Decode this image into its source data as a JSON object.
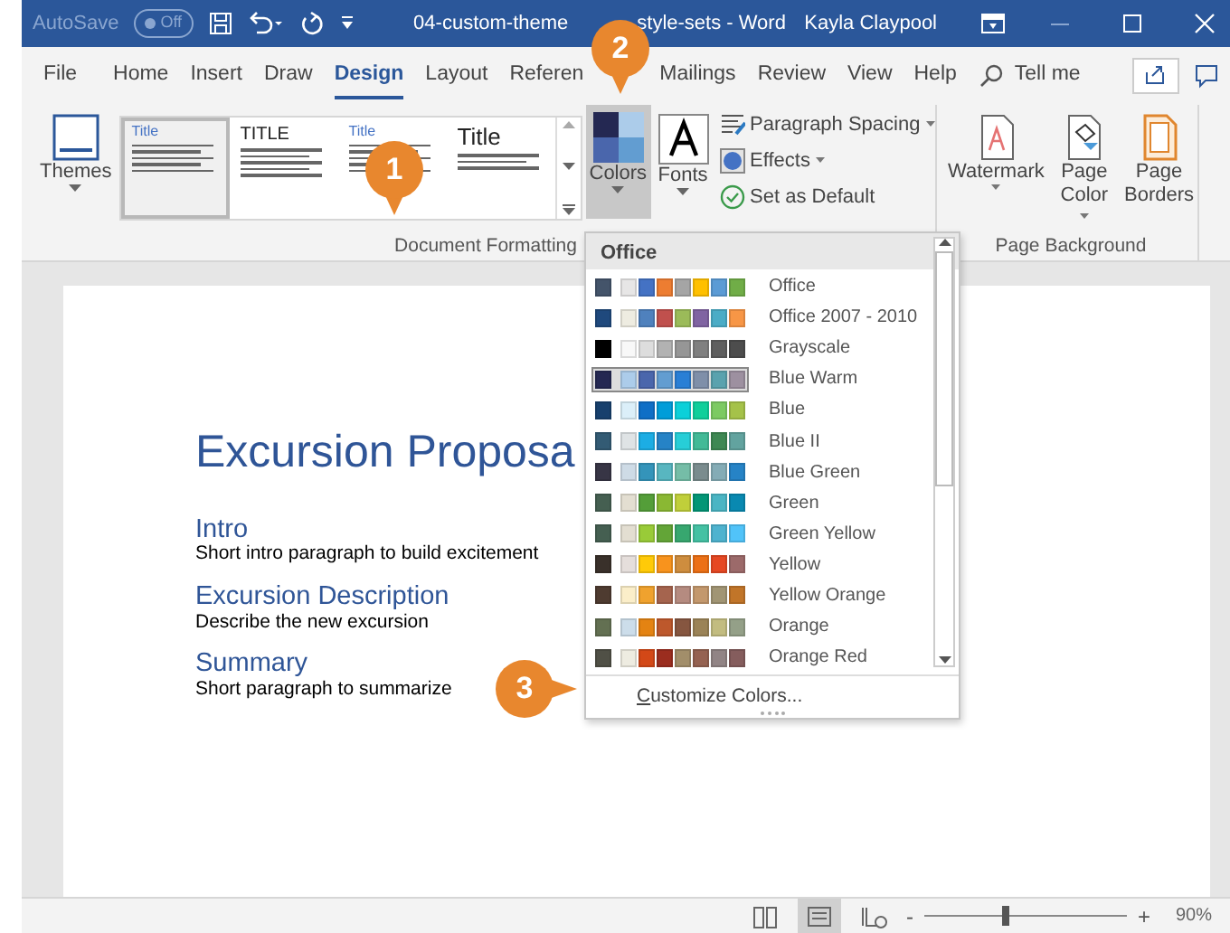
{
  "title_bar": {
    "autosave": "AutoSave",
    "autosave_toggle": "Off",
    "title_parts": [
      "04-custom-theme",
      "style-sets - Word"
    ],
    "user": "Kayla Claypool"
  },
  "tabs": [
    {
      "label": "File",
      "selected": false
    },
    {
      "label": "Home",
      "selected": false
    },
    {
      "label": "Insert",
      "selected": false
    },
    {
      "label": "Draw",
      "selected": false
    },
    {
      "label": "Design",
      "selected": true
    },
    {
      "label": "Layout",
      "selected": false
    },
    {
      "label": "Referen",
      "selected": false
    },
    {
      "label": "Mailings",
      "selected": false
    },
    {
      "label": "Review",
      "selected": false
    },
    {
      "label": "View",
      "selected": false
    },
    {
      "label": "Help",
      "selected": false
    }
  ],
  "tell_me": "Tell me",
  "ribbon": {
    "themes": "Themes",
    "style_gallery": [
      {
        "title": "Title",
        "selected": true
      },
      {
        "title": "TITLE",
        "selected": false
      },
      {
        "title": "Title",
        "selected": false
      },
      {
        "title": "Title",
        "selected": false
      }
    ],
    "colors": "Colors",
    "fonts": "Fonts",
    "small_buttons": [
      {
        "label": "Paragraph Spacing",
        "dropdown": true,
        "kind": "spacing"
      },
      {
        "label": "Effects",
        "dropdown": true,
        "kind": "effects"
      },
      {
        "label": "Set as Default",
        "dropdown": false,
        "kind": "default"
      }
    ],
    "document_formatting": "Document Formatting",
    "page_buttons": [
      {
        "label": "Watermark",
        "dropdown": true,
        "kind": "watermark"
      },
      {
        "label": "Page Color",
        "dropdown": true,
        "kind": "color"
      },
      {
        "label": "Page Borders",
        "dropdown": false,
        "kind": "borders"
      }
    ],
    "page_background": "Page Background"
  },
  "document": {
    "title": "Excursion Proposa",
    "sections": [
      {
        "heading": "Intro",
        "body": "Short intro paragraph to build excitement"
      },
      {
        "heading": "Excursion Description",
        "body": "Describe the new excursion"
      },
      {
        "heading": "Summary",
        "body": "Short paragraph to summarize"
      }
    ]
  },
  "colors_menu": {
    "header": "Office",
    "palettes": [
      {
        "name": "Office",
        "selected": false,
        "swatches": [
          {
            "color": "#44546a"
          },
          {
            "color": "#e7e6e6"
          },
          {
            "color": "#4472c4"
          },
          {
            "color": "#ed7d31"
          },
          {
            "color": "#a5a5a5"
          },
          {
            "color": "#ffc000"
          },
          {
            "color": "#5b9bd5"
          },
          {
            "color": "#70ad47"
          }
        ]
      },
      {
        "name": "Office 2007 - 2010",
        "selected": false,
        "swatches": [
          {
            "color": "#1f497d"
          },
          {
            "color": "#eeece1"
          },
          {
            "color": "#4f81bd"
          },
          {
            "color": "#c0504d"
          },
          {
            "color": "#9bbb59"
          },
          {
            "color": "#8064a2"
          },
          {
            "color": "#4bacc6"
          },
          {
            "color": "#f79646"
          }
        ]
      },
      {
        "name": "Grayscale",
        "selected": false,
        "swatches": [
          {
            "color": "#000000"
          },
          {
            "color": "#f8f8f8"
          },
          {
            "color": "#dddddd"
          },
          {
            "color": "#b2b2b2"
          },
          {
            "color": "#969696"
          },
          {
            "color": "#808080"
          },
          {
            "color": "#5f5f5f"
          },
          {
            "color": "#4d4d4d"
          }
        ]
      },
      {
        "name": "Blue Warm",
        "selected": true,
        "swatches": [
          {
            "color": "#242852"
          },
          {
            "color": "#acccea"
          },
          {
            "color": "#4a66ac"
          },
          {
            "color": "#629dd1"
          },
          {
            "color": "#297fd5"
          },
          {
            "color": "#7f8fa9"
          },
          {
            "color": "#5aa2ae"
          },
          {
            "color": "#9d90a0"
          }
        ]
      },
      {
        "name": "Blue",
        "selected": false,
        "swatches": [
          {
            "color": "#17406d"
          },
          {
            "color": "#dbeff9"
          },
          {
            "color": "#0f6fc6"
          },
          {
            "color": "#009dd9"
          },
          {
            "color": "#0bd0d9"
          },
          {
            "color": "#10cf9b"
          },
          {
            "color": "#7cca62"
          },
          {
            "color": "#a5c249"
          }
        ]
      },
      {
        "name": "Blue II",
        "selected": false,
        "swatches": [
          {
            "color": "#335b74"
          },
          {
            "color": "#dfe3e5"
          },
          {
            "color": "#1cade4"
          },
          {
            "color": "#2683c6"
          },
          {
            "color": "#27ced7"
          },
          {
            "color": "#42ba97"
          },
          {
            "color": "#3e8853"
          },
          {
            "color": "#62a39f"
          }
        ]
      },
      {
        "name": "Blue Green",
        "selected": false,
        "swatches": [
          {
            "color": "#373545"
          },
          {
            "color": "#cedbe6"
          },
          {
            "color": "#3494ba"
          },
          {
            "color": "#58b6c0"
          },
          {
            "color": "#75bda7"
          },
          {
            "color": "#7a8c8e"
          },
          {
            "color": "#84acb6"
          },
          {
            "color": "#2683c6"
          }
        ]
      },
      {
        "name": "Green",
        "selected": false,
        "swatches": [
          {
            "color": "#455f51"
          },
          {
            "color": "#e3ded1"
          },
          {
            "color": "#549e39"
          },
          {
            "color": "#8ab833"
          },
          {
            "color": "#c0cf3a"
          },
          {
            "color": "#029676"
          },
          {
            "color": "#4ab5c4"
          },
          {
            "color": "#0989b1"
          }
        ]
      },
      {
        "name": "Green Yellow",
        "selected": false,
        "swatches": [
          {
            "color": "#455f51"
          },
          {
            "color": "#e3ded1"
          },
          {
            "color": "#99cb38"
          },
          {
            "color": "#63a537"
          },
          {
            "color": "#37a76f"
          },
          {
            "color": "#44c1a3"
          },
          {
            "color": "#4eb3cf"
          },
          {
            "color": "#51c3f9"
          }
        ]
      },
      {
        "name": "Yellow",
        "selected": false,
        "swatches": [
          {
            "color": "#39302a"
          },
          {
            "color": "#e5dedb"
          },
          {
            "color": "#ffca08"
          },
          {
            "color": "#f8931d"
          },
          {
            "color": "#ce8d3e"
          },
          {
            "color": "#ec7016"
          },
          {
            "color": "#e64823"
          },
          {
            "color": "#9c6a6a"
          }
        ]
      },
      {
        "name": "Yellow Orange",
        "selected": false,
        "swatches": [
          {
            "color": "#4e3b30"
          },
          {
            "color": "#fbeec9"
          },
          {
            "color": "#f0a22e"
          },
          {
            "color": "#a5644e"
          },
          {
            "color": "#b58b80"
          },
          {
            "color": "#c3986d"
          },
          {
            "color": "#a19574"
          },
          {
            "color": "#c17529"
          }
        ]
      },
      {
        "name": "Orange",
        "selected": false,
        "swatches": [
          {
            "color": "#637052"
          },
          {
            "color": "#ccddea"
          },
          {
            "color": "#e48312"
          },
          {
            "color": "#bd582c"
          },
          {
            "color": "#865640"
          },
          {
            "color": "#9b8357"
          },
          {
            "color": "#c2bc80"
          },
          {
            "color": "#94a088"
          }
        ]
      },
      {
        "name": "Orange Red",
        "selected": false,
        "swatches": [
          {
            "color": "#505046"
          },
          {
            "color": "#eeece1"
          },
          {
            "color": "#d34817"
          },
          {
            "color": "#9b2d1f"
          },
          {
            "color": "#a28e6a"
          },
          {
            "color": "#956251"
          },
          {
            "color": "#918485"
          },
          {
            "color": "#855d5d"
          }
        ]
      }
    ],
    "footer": "Customize Colors..."
  },
  "callouts": [
    "1",
    "2",
    "3"
  ],
  "status_bar": {
    "views": [
      {
        "kind": "read",
        "selected": false
      },
      {
        "kind": "print",
        "selected": true
      },
      {
        "kind": "web",
        "selected": false
      }
    ],
    "zoom_out": "-",
    "zoom_in": "+",
    "level": 0.38,
    "zoom": "90%"
  }
}
